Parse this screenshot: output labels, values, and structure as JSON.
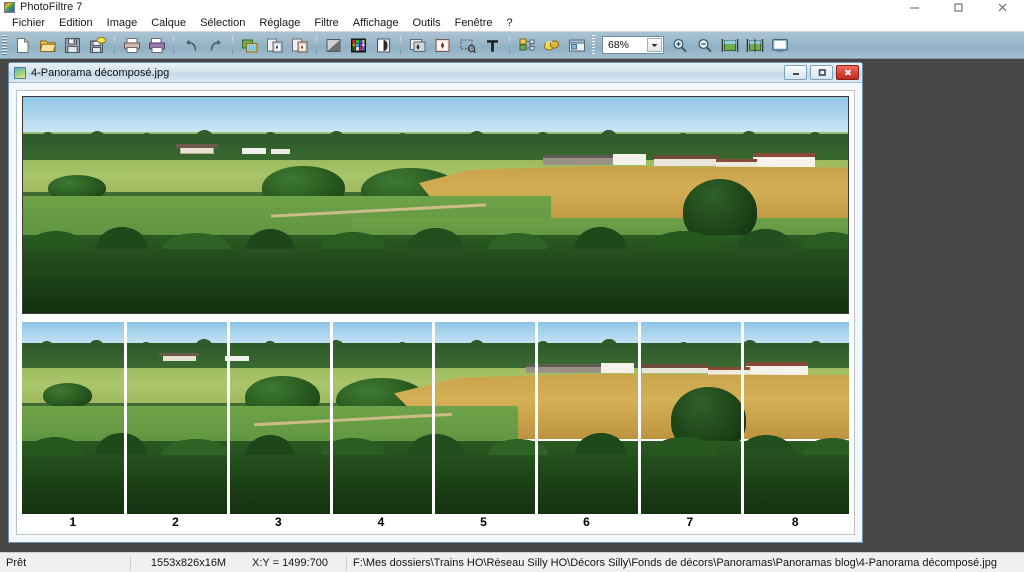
{
  "app": {
    "title": "PhotoFiltre 7",
    "icon": "photofiltre-logo-icon",
    "window_controls": {
      "minimize": "minimize-icon",
      "maximize": "maximize-icon",
      "close": "close-icon"
    }
  },
  "menubar": {
    "items": [
      {
        "label": "Fichier"
      },
      {
        "label": "Edition"
      },
      {
        "label": "Image"
      },
      {
        "label": "Calque"
      },
      {
        "label": "Sélection"
      },
      {
        "label": "Réglage"
      },
      {
        "label": "Filtre"
      },
      {
        "label": "Affichage"
      },
      {
        "label": "Outils"
      },
      {
        "label": "Fenêtre"
      },
      {
        "label": "?"
      }
    ]
  },
  "toolbar": {
    "groups": [
      {
        "buttons": [
          {
            "name": "new-file-icon"
          },
          {
            "name": "open-file-icon"
          },
          {
            "name": "save-file-icon"
          },
          {
            "name": "save-as-icon"
          }
        ]
      },
      {
        "buttons": [
          {
            "name": "print-icon"
          },
          {
            "name": "print-preview-icon"
          }
        ]
      },
      {
        "buttons": [
          {
            "name": "undo-icon"
          },
          {
            "name": "redo-icon"
          }
        ]
      },
      {
        "buttons": [
          {
            "name": "copy-image-icon"
          },
          {
            "name": "paste-as-layer-icon"
          },
          {
            "name": "paste-icon"
          }
        ]
      },
      {
        "buttons": [
          {
            "name": "grayscale-icon"
          },
          {
            "name": "color-palette-icon"
          },
          {
            "name": "adjust-contrast-icon"
          }
        ]
      },
      {
        "buttons": [
          {
            "name": "crop-selection-icon"
          },
          {
            "name": "resize-image-icon"
          },
          {
            "name": "selection-tool-icon"
          },
          {
            "name": "text-tool-icon"
          }
        ]
      },
      {
        "buttons": [
          {
            "name": "layers-icon"
          },
          {
            "name": "effects-icon"
          },
          {
            "name": "image-explorer-icon"
          }
        ]
      }
    ],
    "zoom": {
      "value": "68%",
      "dropdown_icon": "chevron-down-icon"
    },
    "zoom_buttons": [
      {
        "name": "zoom-in-icon"
      },
      {
        "name": "zoom-out-icon"
      },
      {
        "name": "fit-to-window-icon"
      },
      {
        "name": "actual-size-icon"
      },
      {
        "name": "full-screen-icon"
      }
    ]
  },
  "document_window": {
    "icon": "image-document-icon",
    "title": "4-Panorama décomposé.jpg",
    "controls": {
      "minimize": "mdi-minimize-icon",
      "restore": "mdi-restore-icon",
      "close": "mdi-close-icon"
    },
    "segments": [
      {
        "label": "1"
      },
      {
        "label": "2"
      },
      {
        "label": "3"
      },
      {
        "label": "4"
      },
      {
        "label": "5"
      },
      {
        "label": "6"
      },
      {
        "label": "7"
      },
      {
        "label": "8"
      }
    ]
  },
  "statusbar": {
    "state": "Prêt",
    "dimensions": "1553x826x16M",
    "coordinates": "X:Y = 1499:700",
    "file_path": "F:\\Mes dossiers\\Trains HO\\Réseau Silly HO\\Décors Silly\\Fonds de décors\\Panoramas\\Panoramas blog\\4-Panorama décomposé.jpg"
  },
  "colors": {
    "toolbar_blue": "#9bb8ca",
    "workspace_gray": "#464646",
    "mdi_title_blue": "#c3d8e7",
    "close_red": "#c02b1d",
    "status_bg": "#f0f0f0"
  }
}
